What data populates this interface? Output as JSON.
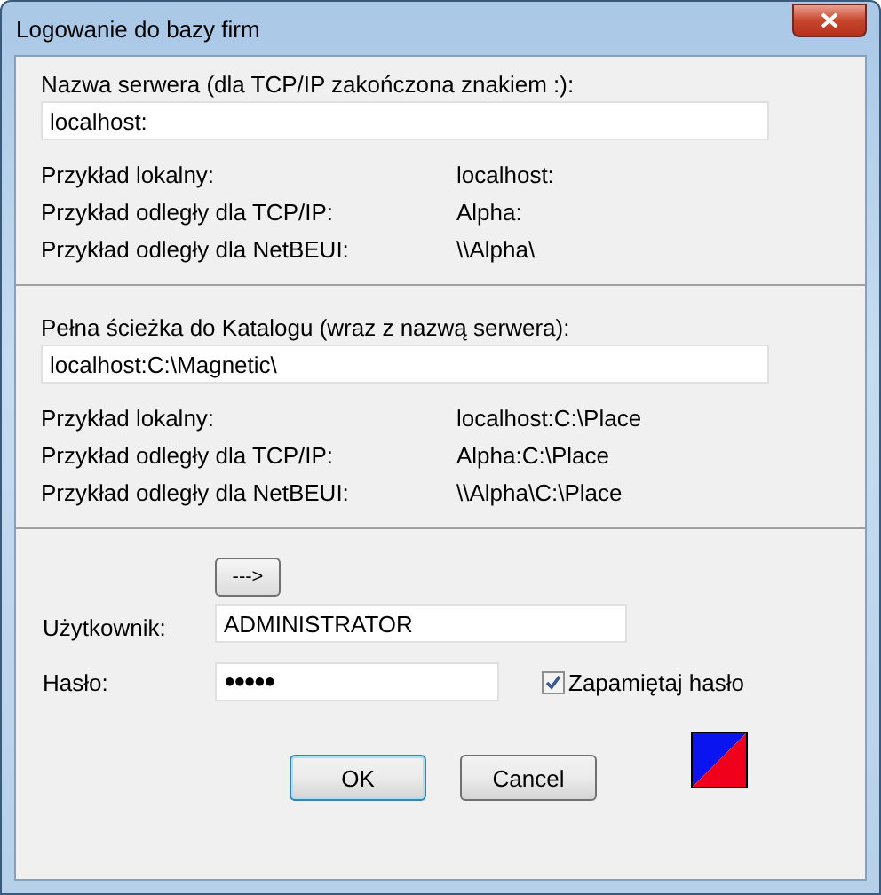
{
  "window": {
    "title": "Logowanie do bazy firm"
  },
  "server": {
    "label": "Nazwa serwera (dla TCP/IP zakończona znakiem :):",
    "value": "localhost:",
    "examples": [
      {
        "label": "Przykład lokalny:",
        "value": "localhost:"
      },
      {
        "label": "Przykład odległy dla TCP/IP:",
        "value": "Alpha:"
      },
      {
        "label": "Przykład odległy dla NetBEUI:",
        "value": "\\\\Alpha\\"
      }
    ]
  },
  "catalog": {
    "label": "Pełna ścieżka do Katalogu (wraz z nazwą serwera):",
    "value": "localhost:C:\\Magnetic\\",
    "examples": [
      {
        "label": "Przykład lokalny:",
        "value": "localhost:C:\\Place"
      },
      {
        "label": "Przykład odległy dla TCP/IP:",
        "value": "Alpha:C:\\Place"
      },
      {
        "label": "Przykład odległy dla NetBEUI:",
        "value": "\\\\Alpha\\C:\\Place"
      }
    ]
  },
  "arrow_button": "--->",
  "user": {
    "label": "Użytkownik:",
    "value": "ADMINISTRATOR"
  },
  "password": {
    "label": "Hasło:",
    "value": "●●●●●"
  },
  "remember": {
    "label": "Zapamiętaj hasło",
    "checked": true
  },
  "buttons": [
    {
      "label": "OK",
      "default": true
    },
    {
      "label": "Cancel",
      "default": false
    }
  ]
}
